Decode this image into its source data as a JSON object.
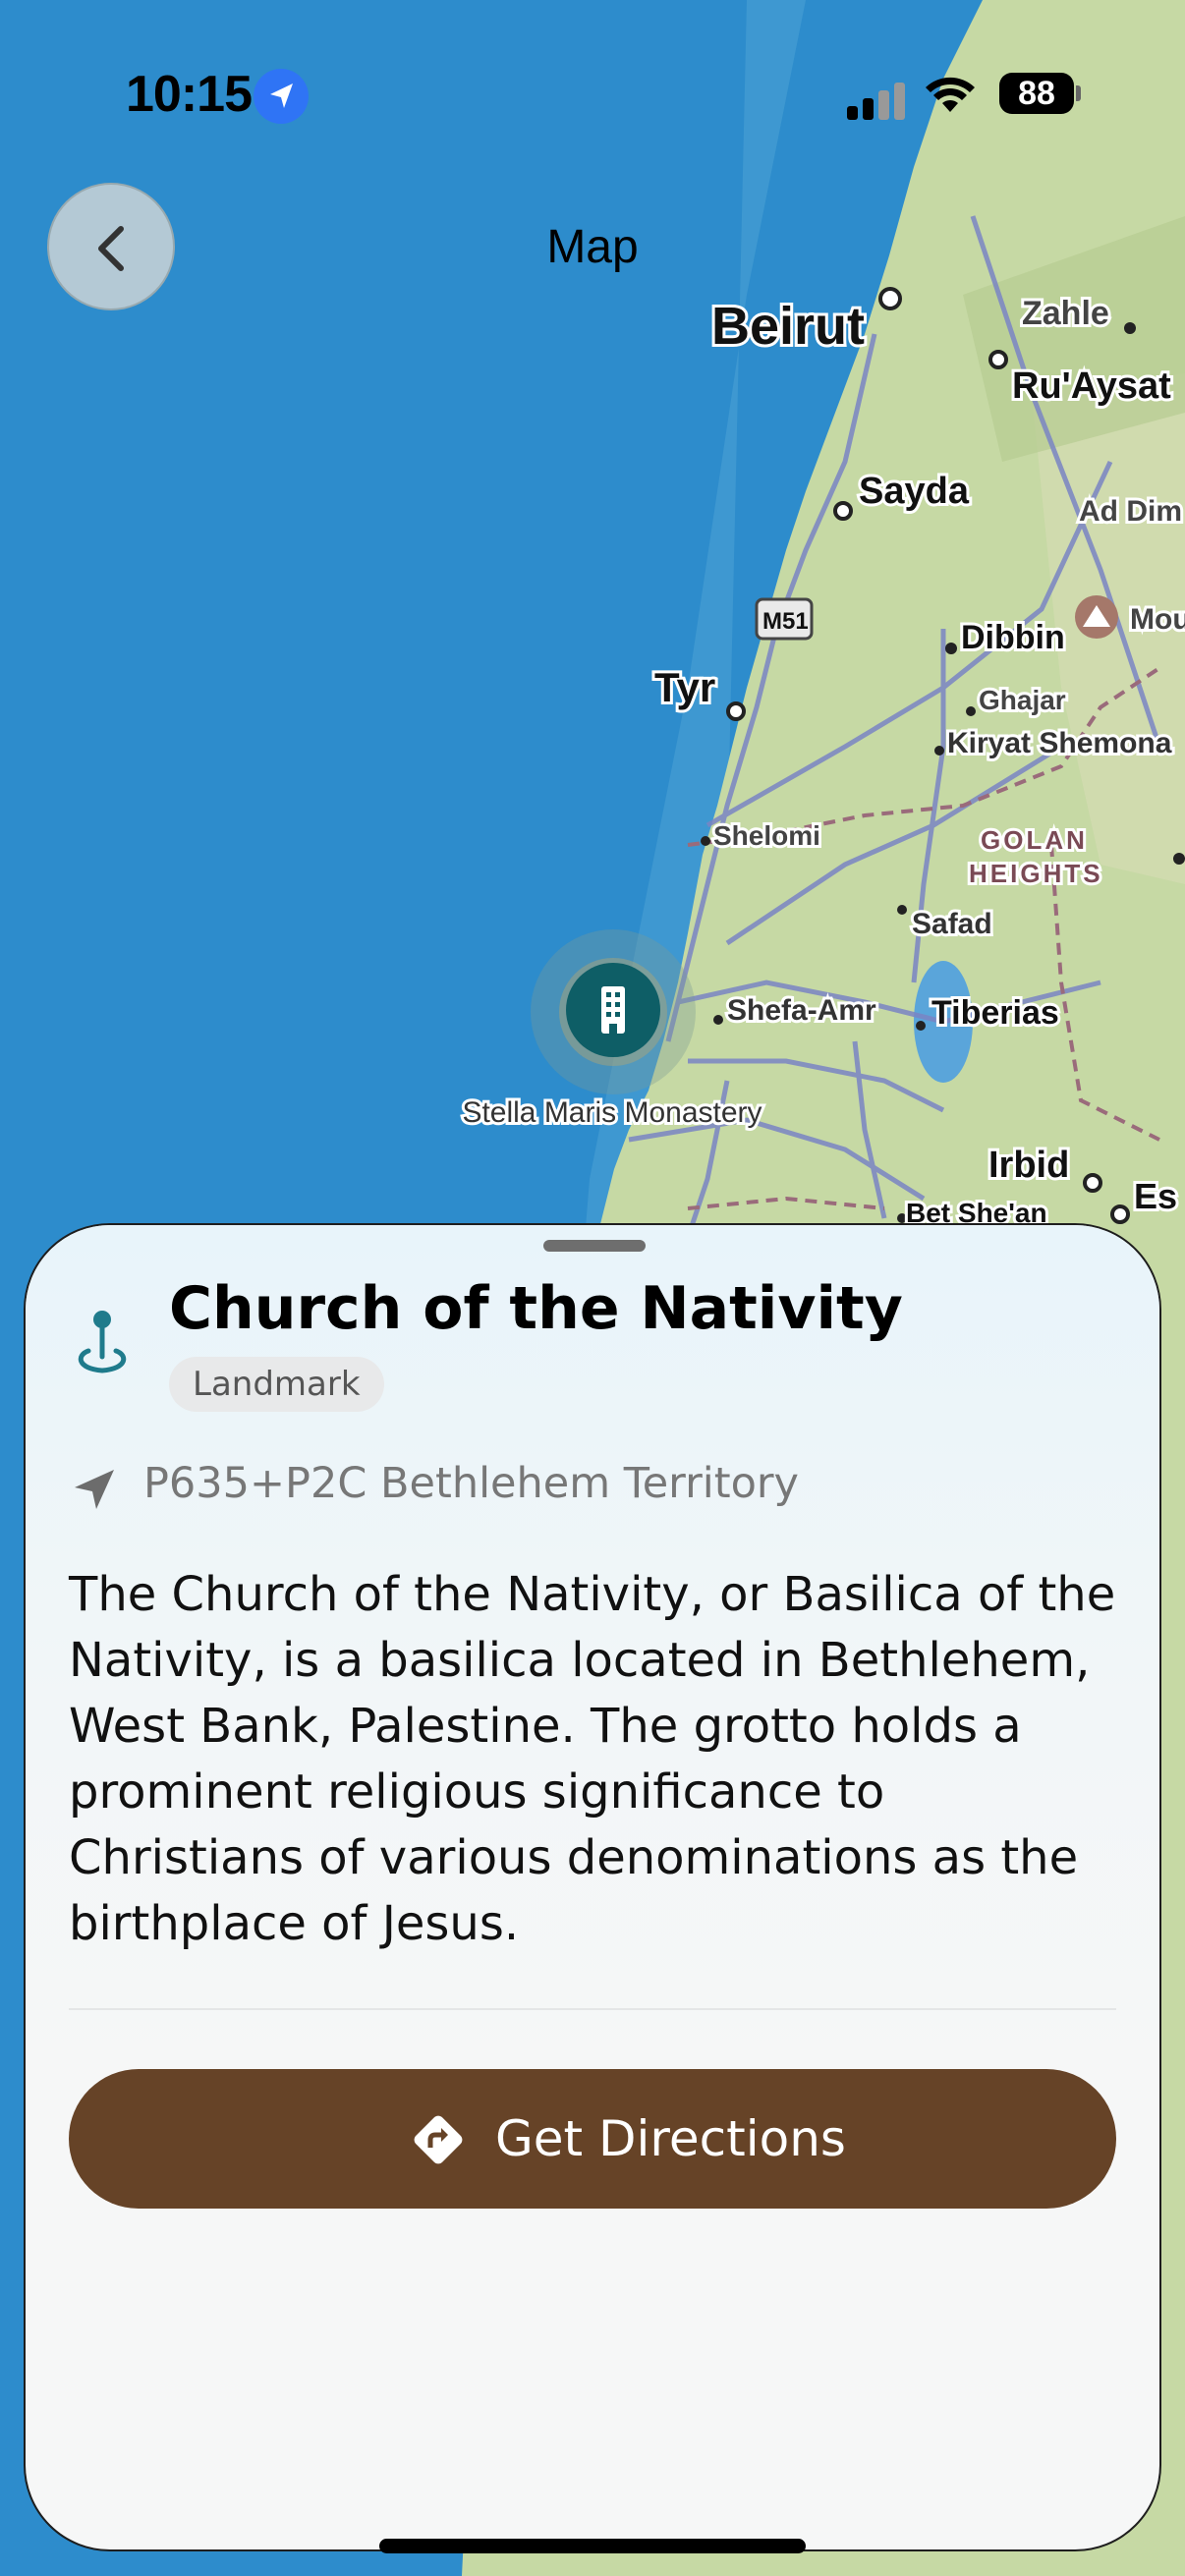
{
  "status_bar": {
    "time": "10:15",
    "battery": "88"
  },
  "nav": {
    "title": "Map",
    "back_icon": "chevron-left-icon"
  },
  "map": {
    "labels": [
      "Beirut",
      "Zahle",
      "Ru'Aysat",
      "Sayda",
      "Ad Dim",
      "M51",
      "Dibbin",
      "Mou",
      "Tyr",
      "Ghajar",
      "Kiryat Shemona",
      "Shelomi",
      "GOLAN",
      "HEIGHTS",
      "Safad",
      "Shefa-Amr",
      "Tiberias",
      "Irbid",
      "Es",
      "Bet She'an",
      "Stella Maris Monastery"
    ],
    "colors": {
      "sea": "#2d8ccc",
      "land": "#c5d9a4",
      "roads": "#7a85c4",
      "marker": "#0e5e66"
    }
  },
  "sheet": {
    "title": "Church of the Nativity",
    "category": "Landmark",
    "address": "P635+P2C Bethlehem Territory",
    "description": "The Church of the Nativity, or Basilica of the Nativity, is a basilica located in Bethlehem, West Bank, Palestine. The grotto holds a prominent religious significance to Christians of various denominations as the birthplace of Jesus.",
    "directions_label": "Get Directions",
    "colors": {
      "button": "#664327",
      "pin_icon": "#1f7b8c"
    }
  }
}
